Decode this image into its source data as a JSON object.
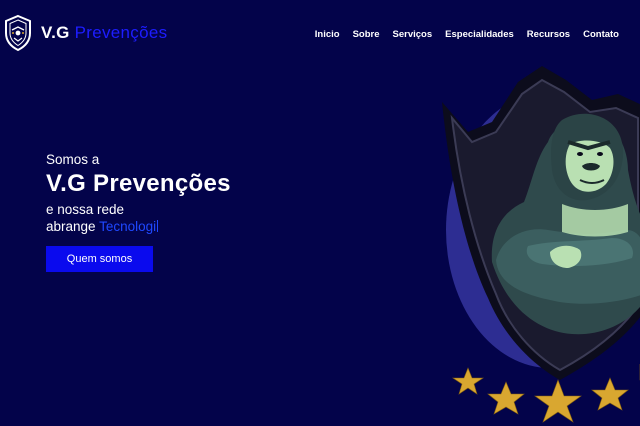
{
  "header": {
    "brand_primary": "V.G",
    "brand_secondary": "Prevenções",
    "logo_icon": "shield-crest-icon"
  },
  "nav": {
    "items": [
      {
        "label": "Inicio"
      },
      {
        "label": "Sobre"
      },
      {
        "label": "Serviços"
      },
      {
        "label": "Especialidades"
      },
      {
        "label": "Recursos"
      },
      {
        "label": "Contato"
      }
    ]
  },
  "hero": {
    "intro": "Somos a",
    "title": "V.G Prevenções",
    "line2": "e nossa rede",
    "line3_prefix": "abrange",
    "typed_text": "Tecnologi",
    "cta_label": "Quem somos"
  },
  "mascot": {
    "icon": "gorilla-shield-illustration",
    "stars": "gold-stars-icon"
  },
  "colors": {
    "background": "#03034a",
    "accent_blue": "#1d1dff",
    "button": "#0a0aee",
    "star": "#d9a730"
  }
}
